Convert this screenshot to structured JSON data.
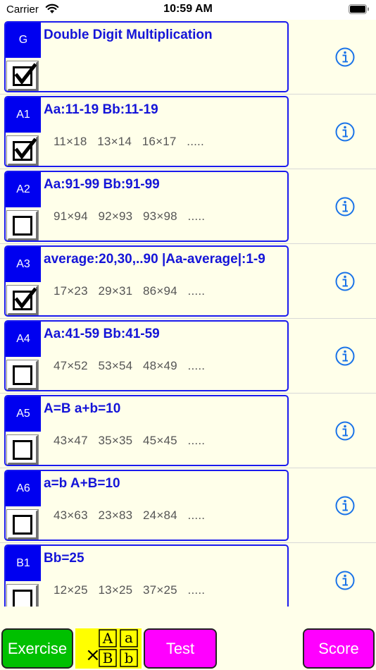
{
  "status": {
    "carrier": "Carrier",
    "time": "10:59 AM"
  },
  "rows": [
    {
      "badge": "G",
      "title": "Double Digit Multiplication",
      "example": "",
      "checked": true
    },
    {
      "badge": "A1",
      "title": "Aa:11-19 Bb:11-19",
      "example": "11×18   13×14   16×17   .....",
      "checked": true
    },
    {
      "badge": "A2",
      "title": "Aa:91-99 Bb:91-99",
      "example": "91×94   92×93   93×98   .....",
      "checked": false
    },
    {
      "badge": "A3",
      "title": "average:20,30,..90 |Aa-average|:1-9",
      "example": "17×23   29×31   86×94   .....",
      "checked": true
    },
    {
      "badge": "A4",
      "title": "Aa:41-59 Bb:41-59",
      "example": "47×52   53×54   48×49   .....",
      "checked": false
    },
    {
      "badge": "A5",
      "title": "A=B a+b=10",
      "example": "43×47   35×35   45×45   .....",
      "checked": false
    },
    {
      "badge": "A6",
      "title": "a=b A+B=10",
      "example": "43×63   23×83   24×84   .....",
      "checked": false
    },
    {
      "badge": "B1",
      "title": "Bb=25",
      "example": "12×25   13×25   37×25   .....",
      "checked": false
    }
  ],
  "buttons": {
    "exercise": "Exercise",
    "test": "Test",
    "score": "Score"
  },
  "logo": {
    "a_upper": "A",
    "a_lower": "a",
    "b_upper": "B",
    "b_lower": "b",
    "times": "×"
  },
  "colors": {
    "badge": "#0000f0",
    "title": "#1414d8",
    "info": "#1a73e8",
    "exercise": "#00c000",
    "test": "#ff00ff",
    "score": "#ff00ff",
    "logo_bg": "#ffff00"
  },
  "icons": {
    "info": "info-circle-icon",
    "checkbox": "checkbox-icon",
    "wifi": "wifi-icon",
    "battery": "battery-icon"
  }
}
